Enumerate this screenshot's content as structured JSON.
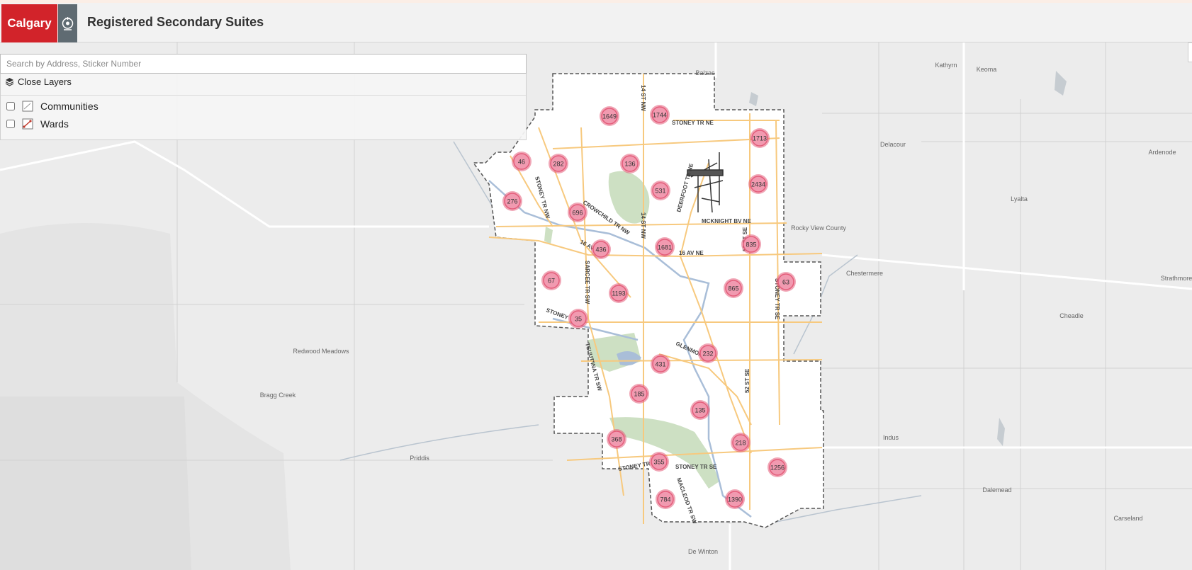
{
  "header": {
    "logo_text": "Calgary",
    "title": "Registered Secondary Suites"
  },
  "search": {
    "placeholder": "Search by Address, Sticker Number",
    "value": ""
  },
  "layers": {
    "toggle_label": "Close Layers",
    "items": [
      {
        "label": "Communities",
        "checked": false,
        "icon": "polygon-icon"
      },
      {
        "label": "Wards",
        "checked": false,
        "icon": "ward-polygon-icon"
      }
    ]
  },
  "map": {
    "cluster_color": "#e45c7a",
    "clusters": [
      "1649",
      "1744",
      "1713",
      "46",
      "282",
      "136",
      "276",
      "531",
      "2434",
      "696",
      "835",
      "436",
      "1681",
      "67",
      "1193",
      "865",
      "63",
      "35",
      "232",
      "431",
      "185",
      "135",
      "368",
      "218",
      "355",
      "1256",
      "784",
      "1390"
    ],
    "place_labels": [
      "Kathyrn",
      "Keoma",
      "Delacour",
      "Ardenode",
      "Lyalta",
      "Rocky View County",
      "Chestermere",
      "Strathmore",
      "Cheadle",
      "Redwood Meadows",
      "Bragg Creek",
      "Priddis",
      "Indus",
      "Dalemead",
      "Carseland",
      "De Winton",
      "Balzac"
    ],
    "road_labels": [
      "STONEY TR NE",
      "14 ST NW",
      "STONEY TR NW",
      "CROWCHILD TR NW",
      "DEERFOOT TR NE",
      "MCKNIGHT BV NE",
      "14 ST NW",
      "16 AV NE",
      "16 AV",
      "SARCEE TR SW",
      "52 ST SE",
      "STONEY TR SE",
      "STONEY TR",
      "GLENMORE",
      "TSUUT'INA TR SW",
      "52 ST SE",
      "STONEY TR SE",
      "STONEY TR S",
      "MACLEOD TR SW"
    ]
  }
}
